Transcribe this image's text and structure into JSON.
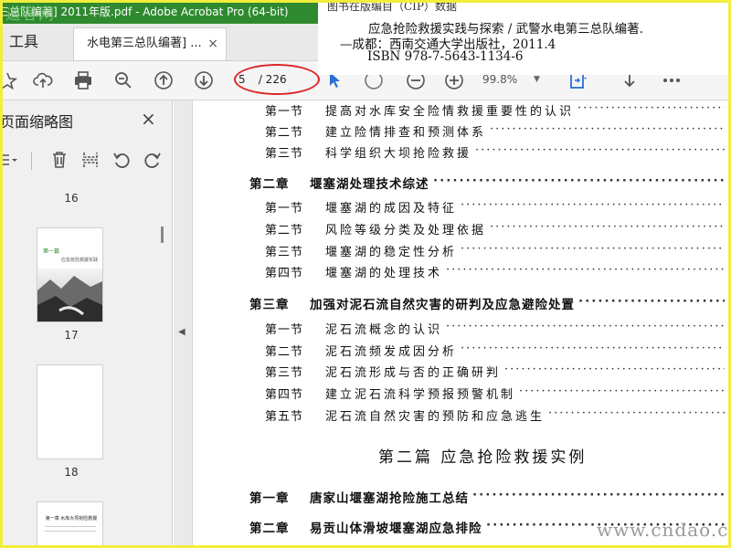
{
  "window": {
    "title": "三总队编著] 2011年版.pdf - Adobe Acrobat Pro (64-bit)",
    "watermark_top": "道客网"
  },
  "tabs": {
    "tools_label": "工具",
    "doc_label": "水电第三总队编著] ...",
    "close_glyph": "×",
    "help_glyph": "?"
  },
  "toolbar": {
    "current_page": "5",
    "total_pages": "/ 226",
    "zoom": "99.8%"
  },
  "citation": {
    "line1": "图书在版编目（CIP）数据",
    "line2": "应急抢险救援实践与探索 / 武警水电第三总队编著.",
    "line3": "—成都：西南交通大学出版社，2011.4",
    "line4": "ISBN 978-7-5643-1134-6"
  },
  "thumbnail_panel": {
    "title": "页面缩略图",
    "close_glyph": "×",
    "pages": [
      {
        "label": "16"
      },
      {
        "label": "17",
        "heading": "第一篇",
        "subtitle": "应急抢险救援实践"
      },
      {
        "label": "18"
      },
      {
        "label": "",
        "heading": "第一章 水库大坝抢险救援"
      }
    ]
  },
  "toc": {
    "part2": "第二篇 应急抢险救援实例",
    "rows": [
      {
        "kind": "sec",
        "n": "第一节",
        "t": "提高对水库安全险情救援重要性的认识"
      },
      {
        "kind": "sec",
        "n": "第二节",
        "t": "建立险情排查和预测体系"
      },
      {
        "kind": "sec",
        "n": "第三节",
        "t": "科学组织大坝抢险救援"
      },
      {
        "kind": "ch",
        "n": "第二章",
        "t": "堰塞湖处理技术综述"
      },
      {
        "kind": "sec",
        "n": "第一节",
        "t": "堰塞湖的成因及特征"
      },
      {
        "kind": "sec",
        "n": "第二节",
        "t": "风险等级分类及处理依据"
      },
      {
        "kind": "sec",
        "n": "第三节",
        "t": "堰塞湖的稳定性分析"
      },
      {
        "kind": "sec",
        "n": "第四节",
        "t": "堰塞湖的处理技术"
      },
      {
        "kind": "ch",
        "n": "第三章",
        "t": "加强对泥石流自然灾害的研判及应急避险处置"
      },
      {
        "kind": "sec",
        "n": "第一节",
        "t": "泥石流概念的认识"
      },
      {
        "kind": "sec",
        "n": "第二节",
        "t": "泥石流频发成因分析"
      },
      {
        "kind": "sec",
        "n": "第三节",
        "t": "泥石流形成与否的正确研判"
      },
      {
        "kind": "sec",
        "n": "第四节",
        "t": "建立泥石流科学预报预警机制"
      },
      {
        "kind": "sec",
        "n": "第五节",
        "t": "泥石流自然灾害的预防和应急逃生"
      },
      {
        "kind": "ch",
        "n": "第一章",
        "t": "唐家山堰塞湖抢险施工总结"
      },
      {
        "kind": "ch",
        "n": "第二章",
        "t": "易贡山体滑坡堰塞湖应急排险"
      }
    ]
  },
  "watermark_bottom": "www.cndao.com"
}
